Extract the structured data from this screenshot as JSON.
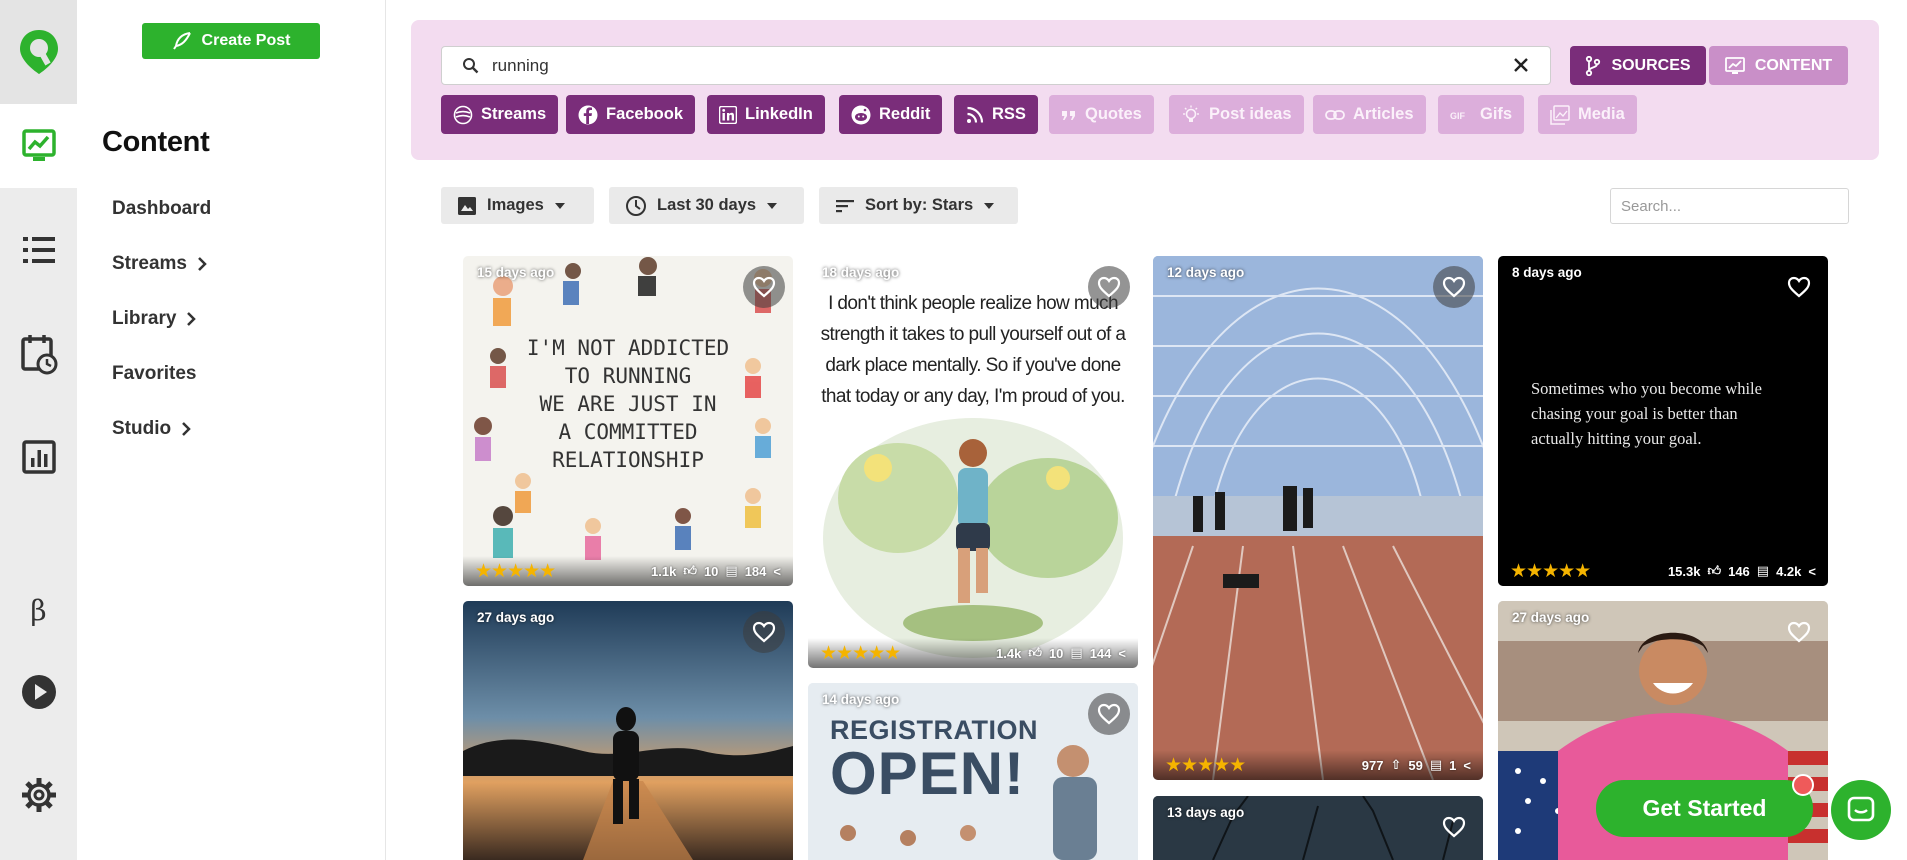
{
  "sidebar": {
    "create_post_label": "Create Post",
    "section_title": "Content",
    "items": [
      {
        "label": "Dashboard"
      },
      {
        "label": "Streams"
      },
      {
        "label": "Library"
      },
      {
        "label": "Favorites"
      },
      {
        "label": "Studio"
      }
    ],
    "beta_label": "β"
  },
  "search": {
    "value": "running"
  },
  "modes": {
    "sources_label": "SOURCES",
    "content_label": "CONTENT"
  },
  "sources": [
    {
      "label": "Streams",
      "icon": "streams-icon",
      "active": true
    },
    {
      "label": "Facebook",
      "icon": "facebook-icon",
      "active": true
    },
    {
      "label": "LinkedIn",
      "icon": "linkedin-icon",
      "active": true
    },
    {
      "label": "Reddit",
      "icon": "reddit-icon",
      "active": true
    },
    {
      "label": "RSS",
      "icon": "rss-icon",
      "active": true
    },
    {
      "label": "Quotes",
      "icon": "quotes-icon",
      "active": false
    },
    {
      "label": "Post ideas",
      "icon": "lightbulb-icon",
      "active": false
    },
    {
      "label": "Articles",
      "icon": "link-icon",
      "active": false
    },
    {
      "label": "Gifs",
      "icon": "gif-icon",
      "active": false
    },
    {
      "label": "Media",
      "icon": "media-icon",
      "active": false
    }
  ],
  "filters": {
    "type_label": "Images",
    "range_label": "Last 30 days",
    "sort_label": "Sort by: Stars",
    "search_placeholder": "Search..."
  },
  "cards": [
    {
      "age": "15 days ago",
      "stars": "★★★★★",
      "likes": "1.1k",
      "comments": "10",
      "shares": "184",
      "quote_lines": [
        "I'M NOT ADDICTED",
        "TO RUNNING",
        "WE ARE JUST IN",
        "A COMMITTED",
        "RELATIONSHIP"
      ]
    },
    {
      "age": "18 days ago",
      "stars": "★★★★★",
      "likes": "1.4k",
      "comments": "10",
      "shares": "144",
      "quote_lines": [
        "I don't think people realize how much",
        "strength it takes to pull yourself out of a",
        "dark place mentally. So if you've done",
        "that today or any day, I'm proud of you."
      ]
    },
    {
      "age": "12 days ago",
      "stars": "★★★★★",
      "likes": "977",
      "comments": "59",
      "shares": "1"
    },
    {
      "age": "8 days ago",
      "stars": "★★★★★",
      "likes": "15.3k",
      "comments": "146",
      "shares": "4.2k",
      "quote_lines": [
        "Sometimes who you become while",
        "chasing your goal is better than",
        "actually hitting your goal."
      ]
    },
    {
      "age": "27 days ago"
    },
    {
      "age": "14 days ago",
      "headline_1": "REGISTRATION",
      "headline_2": "OPEN!"
    },
    {
      "age": "13 days ago"
    },
    {
      "age": "27 days ago"
    }
  ],
  "cta": {
    "get_started_label": "Get Started"
  },
  "colors": {
    "brand_green": "#2db22d",
    "source_purple": "#7a2d7a",
    "topbar_pink": "#f3dcf0",
    "star_gold": "#f5b400"
  }
}
